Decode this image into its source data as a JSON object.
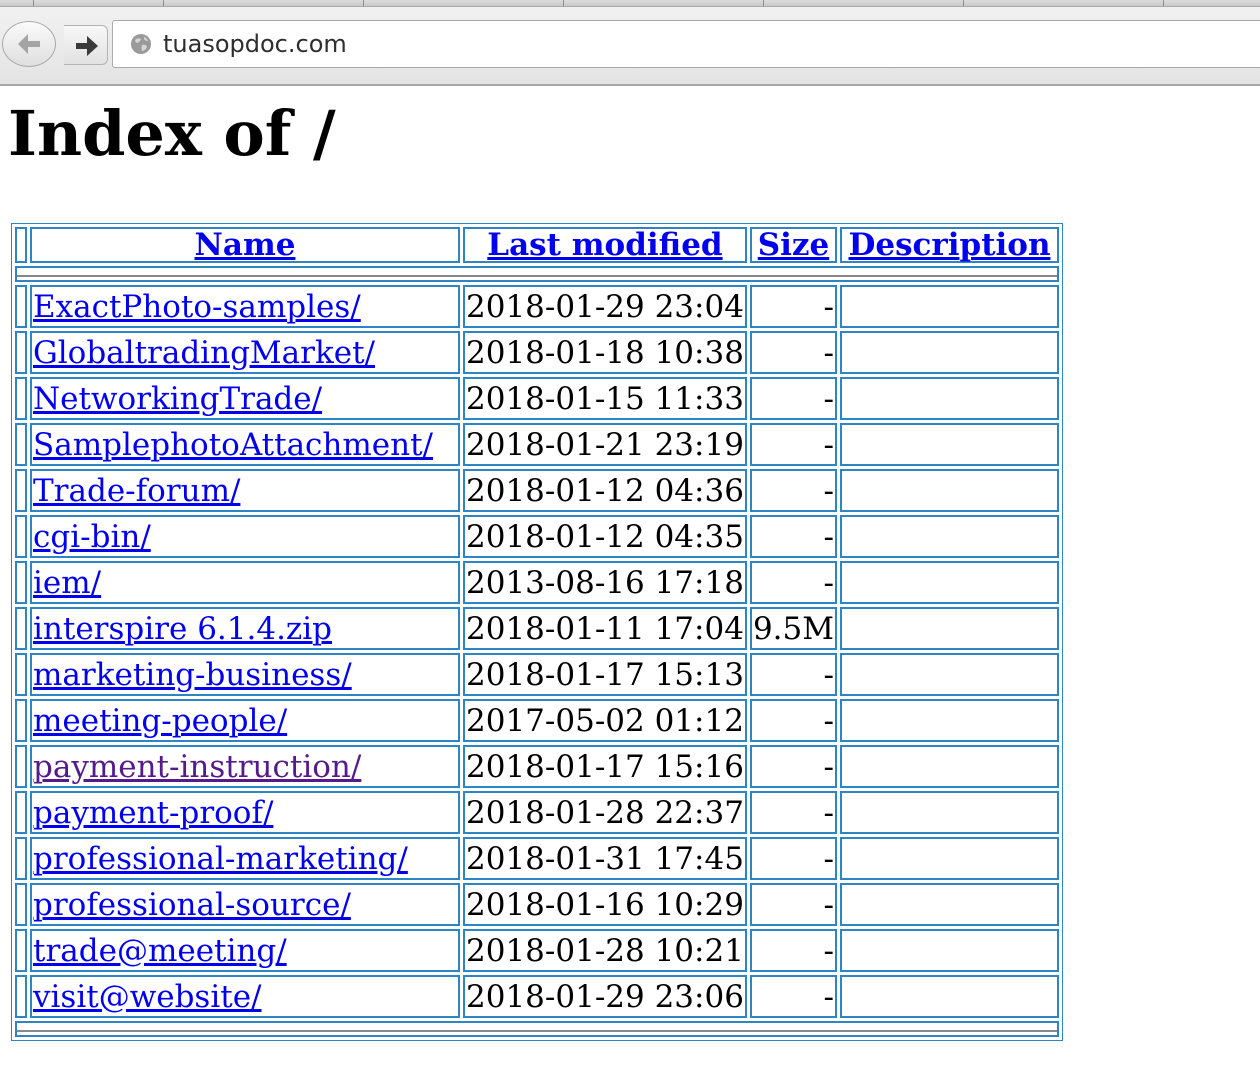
{
  "browser": {
    "url": "tuasopdoc.com",
    "back_icon": "arrow-left-icon",
    "forward_icon": "arrow-right-icon",
    "site_icon": "globe-icon"
  },
  "page": {
    "title": "Index of /",
    "columns": {
      "name": "Name",
      "last_modified": "Last modified",
      "size": "Size",
      "description": "Description"
    },
    "entries": [
      {
        "name": "ExactPhoto-samples/",
        "modified": "2018-01-29 23:04",
        "size": "-",
        "description": ""
      },
      {
        "name": "GlobaltradingMarket/",
        "modified": "2018-01-18 10:38",
        "size": "-",
        "description": ""
      },
      {
        "name": "NetworkingTrade/",
        "modified": "2018-01-15 11:33",
        "size": "-",
        "description": ""
      },
      {
        "name": "SamplephotoAttachment/",
        "modified": "2018-01-21 23:19",
        "size": "-",
        "description": ""
      },
      {
        "name": "Trade-forum/",
        "modified": "2018-01-12 04:36",
        "size": "-",
        "description": ""
      },
      {
        "name": "cgi-bin/",
        "modified": "2018-01-12 04:35",
        "size": "-",
        "description": ""
      },
      {
        "name": "iem/",
        "modified": "2013-08-16 17:18",
        "size": "-",
        "description": ""
      },
      {
        "name": "interspire 6.1.4.zip",
        "modified": "2018-01-11 17:04",
        "size": "9.5M",
        "description": ""
      },
      {
        "name": "marketing-business/",
        "modified": "2018-01-17 15:13",
        "size": "-",
        "description": ""
      },
      {
        "name": "meeting-people/",
        "modified": "2017-05-02 01:12",
        "size": "-",
        "description": ""
      },
      {
        "name": "payment-instruction/",
        "modified": "2018-01-17 15:16",
        "size": "-",
        "description": "",
        "visited": true
      },
      {
        "name": "payment-proof/",
        "modified": "2018-01-28 22:37",
        "size": "-",
        "description": ""
      },
      {
        "name": "professional-marketing/",
        "modified": "2018-01-31 17:45",
        "size": "-",
        "description": ""
      },
      {
        "name": "professional-source/",
        "modified": "2018-01-16 10:29",
        "size": "-",
        "description": ""
      },
      {
        "name": "trade@meeting/",
        "modified": "2018-01-28 10:21",
        "size": "-",
        "description": ""
      },
      {
        "name": "visit@website/",
        "modified": "2018-01-29 23:06",
        "size": "-",
        "description": ""
      }
    ]
  },
  "colors": {
    "link": "#0000ee",
    "visited_link": "#551a8b",
    "table_border": "#2d85c4"
  }
}
